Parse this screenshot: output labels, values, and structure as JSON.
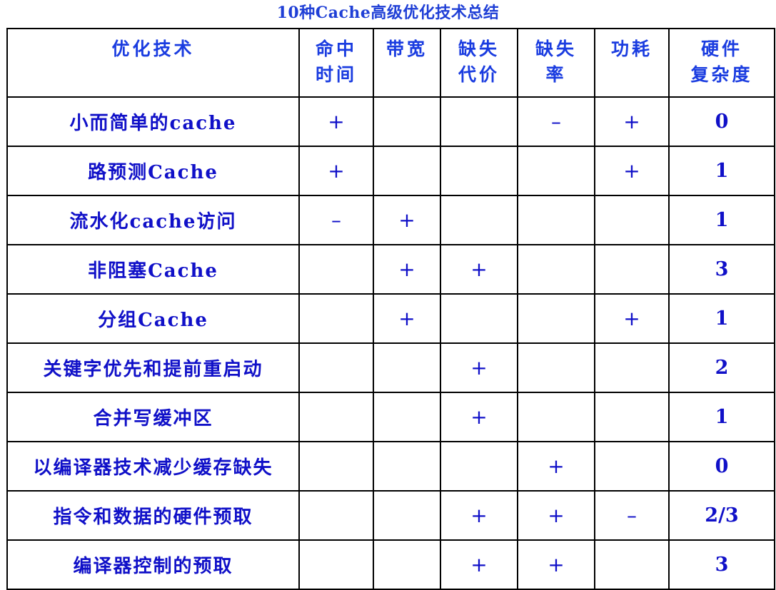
{
  "title": "10种Cache高级优化技术总结",
  "headers": [
    "优化技术",
    "命中\n时间",
    "带宽",
    "缺失\n代价",
    "缺失\n率",
    "功耗",
    "硬件\n复杂度"
  ],
  "rows": [
    {
      "name": "小而简单的cache",
      "marks": [
        "+",
        "",
        "",
        "–",
        "+"
      ],
      "hw": "0"
    },
    {
      "name": "路预测Cache",
      "marks": [
        "+",
        "",
        "",
        "",
        "+"
      ],
      "hw": "1"
    },
    {
      "name": "流水化cache访问",
      "marks": [
        "–",
        "+",
        "",
        "",
        ""
      ],
      "hw": "1"
    },
    {
      "name": "非阻塞Cache",
      "marks": [
        "",
        "+",
        "+",
        "",
        ""
      ],
      "hw": "3"
    },
    {
      "name": "分组Cache",
      "marks": [
        "",
        "+",
        "",
        "",
        "+"
      ],
      "hw": "1"
    },
    {
      "name": "关键字优先和提前重启动",
      "marks": [
        "",
        "",
        "+",
        "",
        ""
      ],
      "hw": "2"
    },
    {
      "name": "合并写缓冲区",
      "marks": [
        "",
        "",
        "+",
        "",
        ""
      ],
      "hw": "1"
    },
    {
      "name": "以编译器技术减少缓存缺失",
      "marks": [
        "",
        "",
        "",
        "+",
        ""
      ],
      "hw": "0"
    },
    {
      "name": "指令和数据的硬件预取",
      "marks": [
        "",
        "",
        "+",
        "+",
        "–"
      ],
      "hw": "2/3"
    },
    {
      "name": "编译器控制的预取",
      "marks": [
        "",
        "",
        "+",
        "+",
        ""
      ],
      "hw": "3"
    }
  ]
}
